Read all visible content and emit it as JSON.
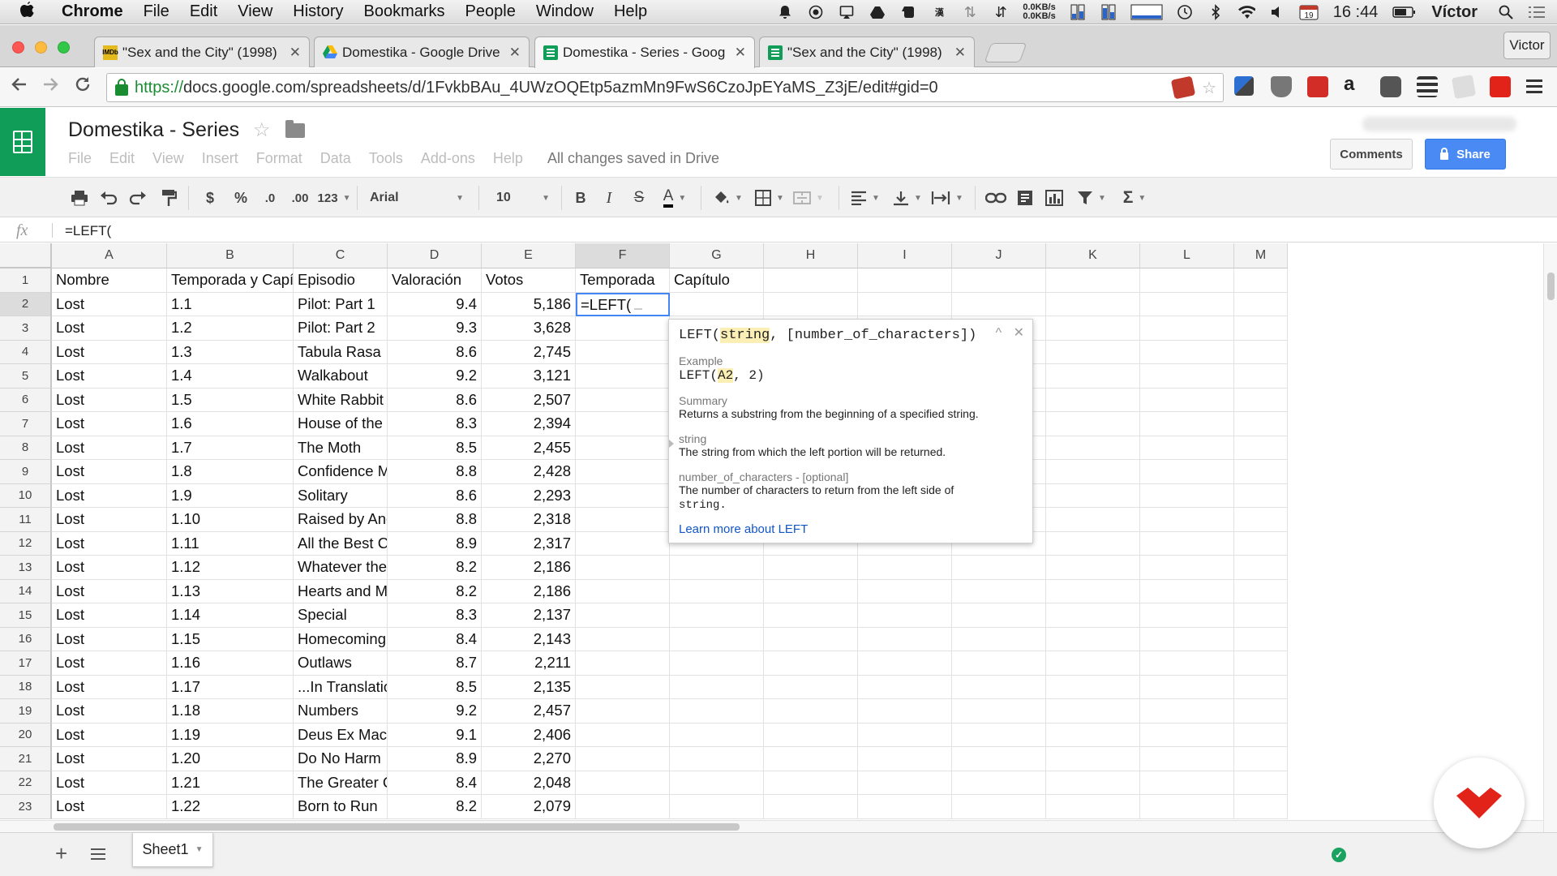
{
  "menubar": {
    "app_name": "Chrome",
    "items": [
      "File",
      "Edit",
      "View",
      "History",
      "Bookmarks",
      "People",
      "Window",
      "Help"
    ],
    "net_up": "0.0KB/s",
    "net_down": "0.0KB/s",
    "time": "16 :44",
    "calendar_day": "19",
    "user": "Víctor"
  },
  "browser": {
    "tabs": [
      {
        "title": "\"Sex and the City\" (1998)",
        "icon": "imdb-icon",
        "favicon_text": "IMDb",
        "active": false
      },
      {
        "title": "Domestika - Google Drive",
        "icon": "drive-icon",
        "active": false
      },
      {
        "title": "Domestika - Series - Goog",
        "icon": "sheets-icon",
        "active": true
      },
      {
        "title": "\"Sex and the City\" (1998)",
        "icon": "sheets-icon",
        "active": false
      }
    ],
    "profile_name": "Victor",
    "url_scheme": "https://",
    "url_rest": "docs.google.com/spreadsheets/d/1FvkbBAu_4UWzOQEtp5azmMn9FwS6CzoJpEYaMS_Z3jE/edit#gid=0"
  },
  "doc": {
    "title": "Domestika - Series",
    "menu": [
      "File",
      "Edit",
      "View",
      "Insert",
      "Format",
      "Data",
      "Tools",
      "Add-ons",
      "Help"
    ],
    "save_status": "All changes saved in Drive",
    "comments_label": "Comments",
    "share_label": "Share"
  },
  "toolbar": {
    "currency": "$",
    "percent": "%",
    "decrease_decimals": ".0",
    "increase_decimals": ".00",
    "number_format": "123",
    "font": "Arial",
    "font_size": "10",
    "bold": "B",
    "italic": "I",
    "strike": "S",
    "text_color": "A",
    "sum": "Σ"
  },
  "formula_bar": {
    "fx": "fx",
    "value": "=LEFT("
  },
  "grid": {
    "columns": [
      "A",
      "B",
      "C",
      "D",
      "E",
      "F",
      "G",
      "H",
      "I",
      "J",
      "K",
      "L",
      "M"
    ],
    "selected_column": "F",
    "selected_row": 2,
    "header_row": [
      "Nombre",
      "Temporada y Capítulo",
      "Episodio",
      "Valoración",
      "Votos",
      "Temporada",
      "Capítulo"
    ],
    "editing_cell_text": "=LEFT(",
    "rows": [
      [
        "Lost",
        "1.1",
        "Pilot: Part 1",
        "9.4",
        "5,186"
      ],
      [
        "Lost",
        "1.2",
        "Pilot: Part 2",
        "9.3",
        "3,628"
      ],
      [
        "Lost",
        "1.3",
        "Tabula Rasa",
        "8.6",
        "2,745"
      ],
      [
        "Lost",
        "1.4",
        "Walkabout",
        "9.2",
        "3,121"
      ],
      [
        "Lost",
        "1.5",
        "White Rabbit",
        "8.6",
        "2,507"
      ],
      [
        "Lost",
        "1.6",
        "House of the Ris",
        "8.3",
        "2,394"
      ],
      [
        "Lost",
        "1.7",
        "The Moth",
        "8.5",
        "2,455"
      ],
      [
        "Lost",
        "1.8",
        "Confidence Man",
        "8.8",
        "2,428"
      ],
      [
        "Lost",
        "1.9",
        "Solitary",
        "8.6",
        "2,293"
      ],
      [
        "Lost",
        "1.10",
        "Raised by Anoth",
        "8.8",
        "2,318"
      ],
      [
        "Lost",
        "1.11",
        "All the Best Cow",
        "8.9",
        "2,317"
      ],
      [
        "Lost",
        "1.12",
        "Whatever the Ca",
        "8.2",
        "2,186"
      ],
      [
        "Lost",
        "1.13",
        "Hearts and Mind",
        "8.2",
        "2,186"
      ],
      [
        "Lost",
        "1.14",
        "Special",
        "8.3",
        "2,137"
      ],
      [
        "Lost",
        "1.15",
        "Homecoming",
        "8.4",
        "2,143"
      ],
      [
        "Lost",
        "1.16",
        "Outlaws",
        "8.7",
        "2,211"
      ],
      [
        "Lost",
        "1.17",
        "...In Translation",
        "8.5",
        "2,135"
      ],
      [
        "Lost",
        "1.18",
        "Numbers",
        "9.2",
        "2,457"
      ],
      [
        "Lost",
        "1.19",
        "Deus Ex Machin",
        "9.1",
        "2,406"
      ],
      [
        "Lost",
        "1.20",
        "Do No Harm",
        "8.9",
        "2,270"
      ],
      [
        "Lost",
        "1.21",
        "The Greater Goo",
        "8.4",
        "2,048"
      ],
      [
        "Lost",
        "1.22",
        "Born to Run",
        "8.2",
        "2,079"
      ]
    ]
  },
  "formula_help": {
    "sig_fn": "LEFT(",
    "sig_arg1": "string",
    "sig_sep": ", ",
    "sig_arg2": "[number_of_characters])",
    "example_label": "Example",
    "example_fn": "LEFT(",
    "example_arg": "A2",
    "example_rest": ", 2)",
    "summary_label": "Summary",
    "summary_text": "Returns a substring from the beginning of a specified string.",
    "param1_name": "string",
    "param1_desc": "The string from which the left portion will be returned.",
    "param2_name": "number_of_characters - [optional]",
    "param2_desc": "The number of characters to return from the left side of",
    "param2_desc_code": "string.",
    "learn_more": "Learn more about LEFT"
  },
  "bottom": {
    "sheet_name": "Sheet1"
  },
  "colors": {
    "sheets_green": "#0f9d58",
    "share_blue": "#4a8af4",
    "selection_blue": "#4285f4",
    "link_blue": "#1155cc",
    "watermark_red": "#e2231a"
  }
}
